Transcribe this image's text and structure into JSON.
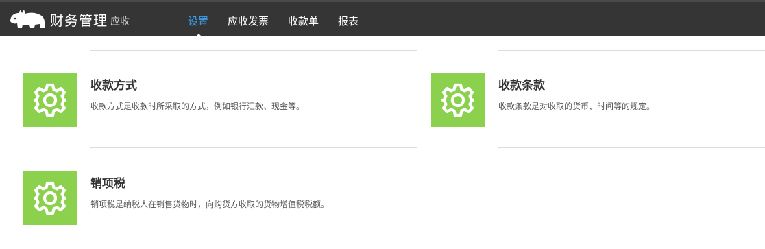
{
  "app": {
    "title": "财务管理",
    "subtitle": "应收"
  },
  "nav": {
    "items": [
      {
        "label": "设置",
        "active": true
      },
      {
        "label": "应收发票",
        "active": false
      },
      {
        "label": "收款单",
        "active": false
      },
      {
        "label": "报表",
        "active": false
      }
    ]
  },
  "cards": [
    {
      "title": "收款方式",
      "desc": "收款方式是收款时所采取的方式，例如银行汇款、现金等。",
      "icon": "gear-icon"
    },
    {
      "title": "收款条款",
      "desc": "收款条款是对收取的货币、时间等的规定。",
      "icon": "gear-icon"
    },
    {
      "title": "销项税",
      "desc": "销项税是纳税人在销售货物时，向购货方收取的货物增值税税额。",
      "icon": "gear-icon"
    }
  ],
  "colors": {
    "header_bg": "#353535",
    "nav_active": "#3d9df0",
    "icon_bg": "#8bd14e",
    "divider": "#dcdcdc"
  }
}
